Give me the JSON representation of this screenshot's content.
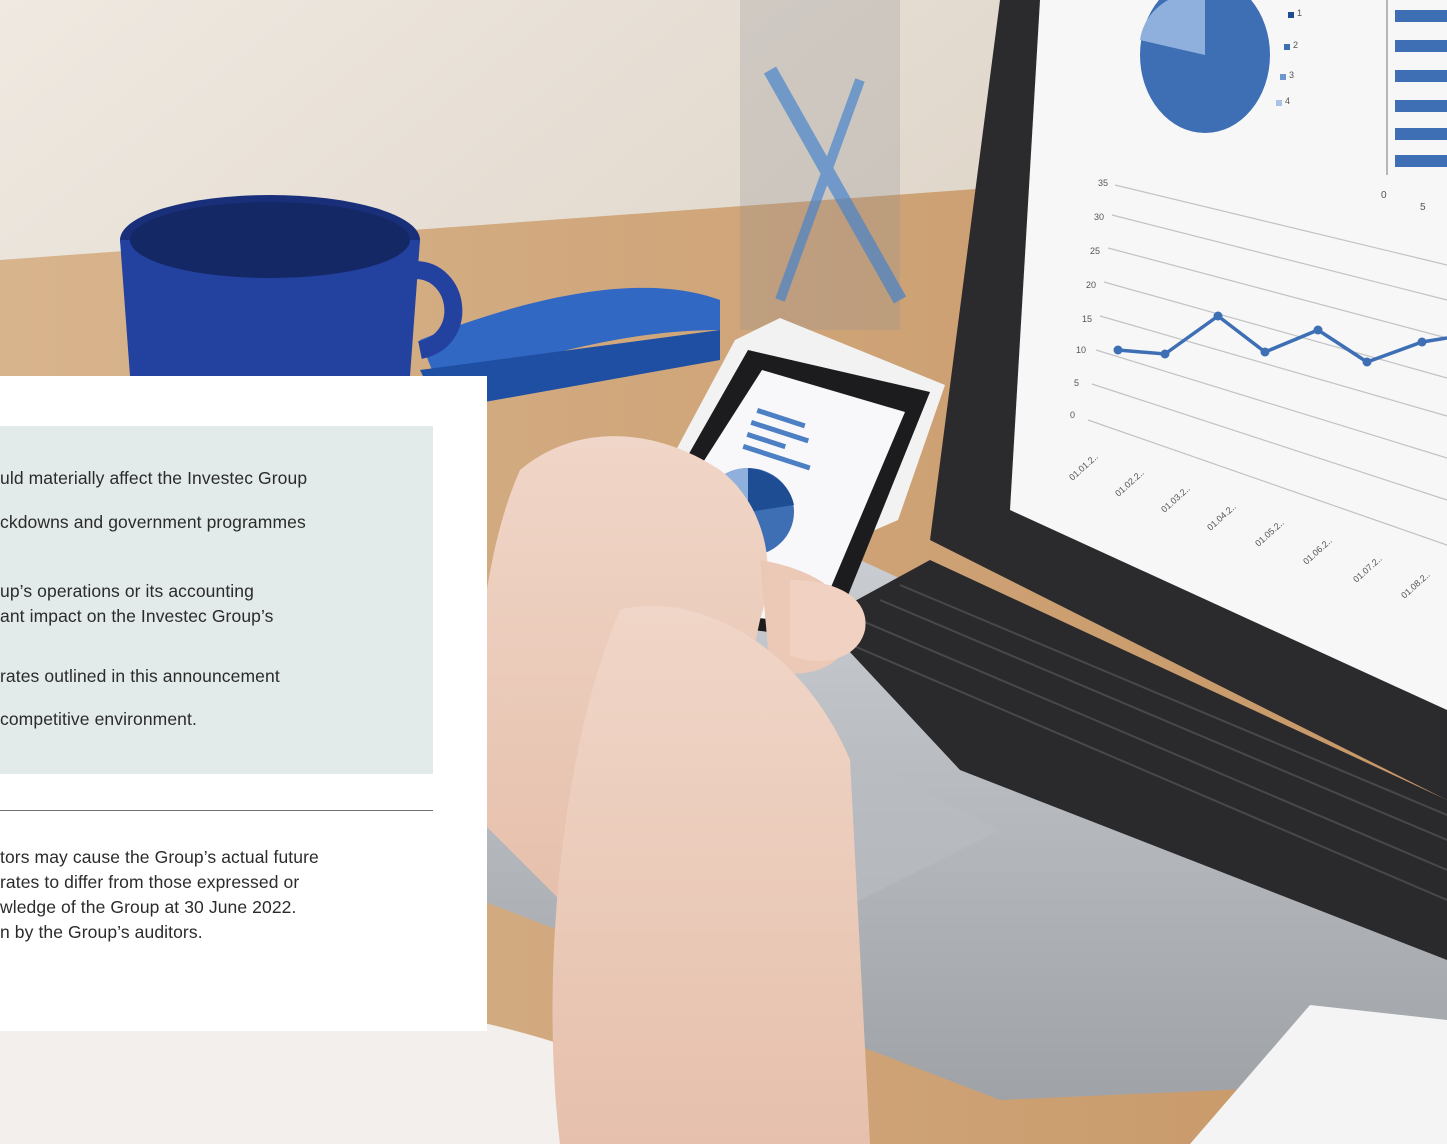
{
  "callout": {
    "lines": [
      "uld materially affect the Investec Group",
      "ckdowns and government programmes",
      "up’s operations or its accounting",
      "ant impact on the Investec Group’s",
      " rates outlined in this announcement",
      "competitive environment."
    ]
  },
  "disclaimer": {
    "lines": [
      "tors may cause the Group’s actual future",
      "rates to differ from those expressed or",
      "wledge of the Group at 30 June 2022.",
      "n by the Group’s auditors."
    ]
  },
  "laptop_chart": {
    "y_ticks": [
      "35",
      "30",
      "25",
      "20",
      "15",
      "10",
      "5",
      "0"
    ],
    "x_ticks": [
      "01.01.2..",
      "01.02.2..",
      "01.03.2..",
      "01.04.2..",
      "01.05.2..",
      "01.06.2..",
      "01.07.2..",
      "01.08.2.."
    ],
    "legend": [
      "1",
      "2",
      "3",
      "4"
    ],
    "bar_axis": [
      "0",
      "5"
    ]
  },
  "colors": {
    "callout_bg": "#e2ebe9",
    "chart_blue": "#3e6fb5",
    "mug_blue": "#1f3f9c"
  }
}
